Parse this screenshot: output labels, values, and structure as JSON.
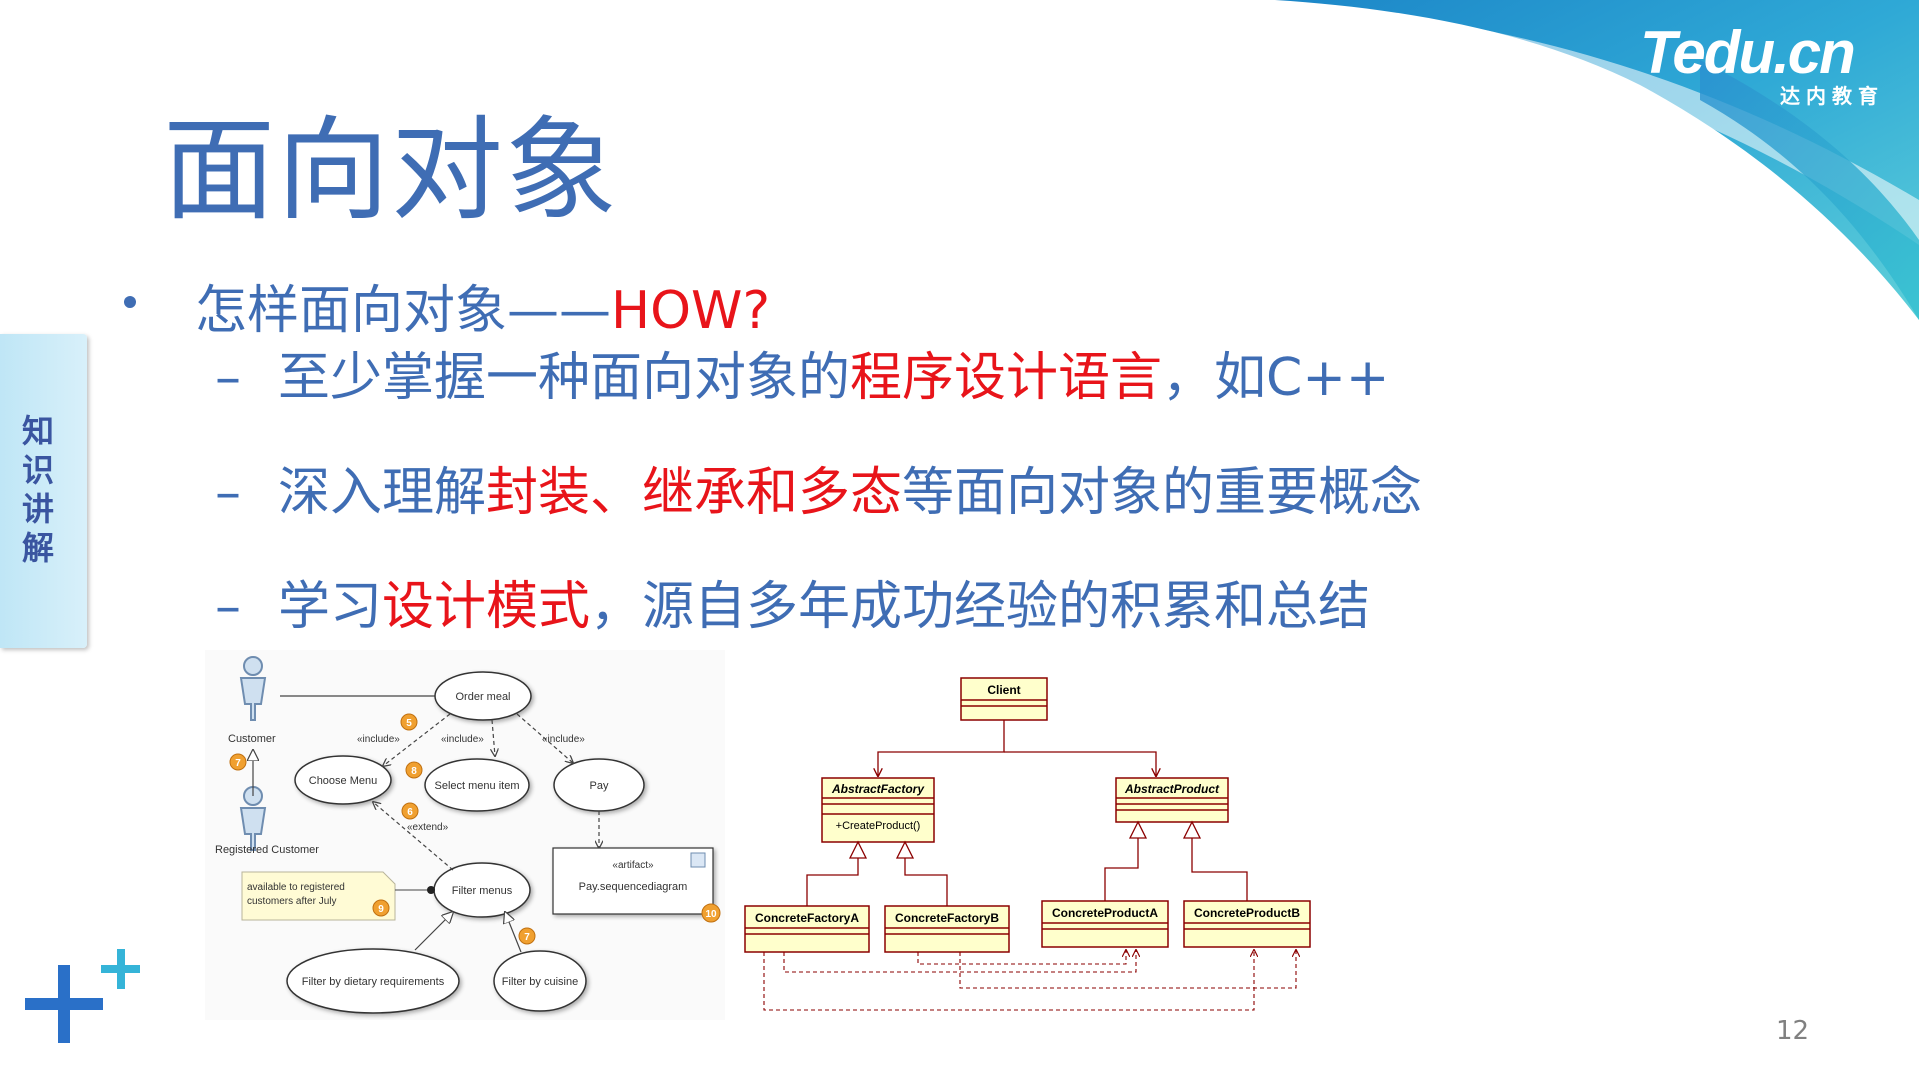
{
  "slide": {
    "title": "面向对象",
    "bullet": {
      "prefix": "怎样面向对象——",
      "highlight": "HOW?"
    },
    "subs": [
      [
        {
          "t": "至少掌握一种面向对象的",
          "c": "blue"
        },
        {
          "t": "程序设计语言",
          "c": "red"
        },
        {
          "t": "，如C++",
          "c": "blue"
        }
      ],
      [
        {
          "t": "深入理解",
          "c": "blue"
        },
        {
          "t": "封装、继承和多态",
          "c": "red"
        },
        {
          "t": "等面向对象的重要概念",
          "c": "blue"
        }
      ],
      [
        {
          "t": "学习",
          "c": "blue"
        },
        {
          "t": "设计模式",
          "c": "red"
        },
        {
          "t": "，源自多年成功经验的积累和总结",
          "c": "blue"
        }
      ]
    ],
    "side_tab": "知识讲解",
    "page_number": "12"
  },
  "logo": {
    "brand": "Tedu.cn",
    "tagline": "达内教育"
  },
  "usecase_diagram": {
    "actors": [
      "Customer",
      "Registered Customer"
    ],
    "usecases": [
      "Order meal",
      "Choose Menu",
      "Select menu item",
      "Pay",
      "Filter menus",
      "Filter by dietary requirements",
      "Filter by cuisine"
    ],
    "stereotypes": [
      "«include»",
      "«include»",
      "«include»",
      "«extend»"
    ],
    "note": [
      "available to registered",
      "customers after July"
    ],
    "artifact": {
      "stereotype": "«artifact»",
      "name": "Pay.sequencediagram"
    },
    "badges": [
      "5",
      "7",
      "8",
      "6",
      "9",
      "7",
      "10"
    ]
  },
  "class_diagram": {
    "classes": [
      "Client",
      "AbstractFactory",
      "AbstractProduct",
      "ConcreteFactoryA",
      "ConcreteFactoryB",
      "ConcreteProductA",
      "ConcreteProductB"
    ],
    "operation": "+CreateProduct()"
  },
  "colors": {
    "title_blue": "#3f6db4",
    "highlight_red": "#e8141a",
    "uml_fill": "#ffffcc",
    "uml_border": "#8b0000"
  }
}
